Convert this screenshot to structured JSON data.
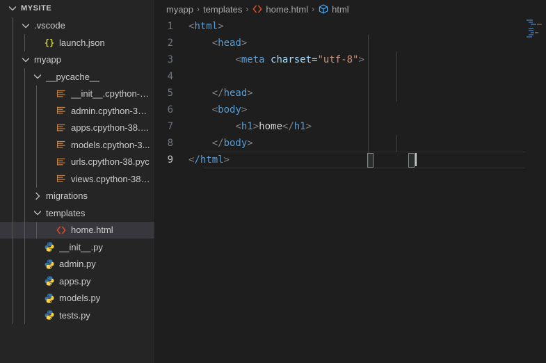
{
  "sidebar": {
    "root": {
      "label": "MYSITE",
      "expanded": true
    },
    "items": [
      {
        "label": ".vscode",
        "type": "folder",
        "depth": 1,
        "expanded": true,
        "icon": "chevron-down-icon"
      },
      {
        "label": "launch.json",
        "type": "file",
        "depth": 2,
        "icon": "json-icon"
      },
      {
        "label": "myapp",
        "type": "folder",
        "depth": 1,
        "expanded": true,
        "icon": "chevron-down-icon"
      },
      {
        "label": "__pycache__",
        "type": "folder",
        "depth": 2,
        "expanded": true,
        "icon": "chevron-down-icon"
      },
      {
        "label": "__init__.cpython-38...",
        "type": "file",
        "depth": 3,
        "icon": "pyc-icon"
      },
      {
        "label": "admin.cpython-38....",
        "type": "file",
        "depth": 3,
        "icon": "pyc-icon"
      },
      {
        "label": "apps.cpython-38.pyc",
        "type": "file",
        "depth": 3,
        "icon": "pyc-icon"
      },
      {
        "label": "models.cpython-3...",
        "type": "file",
        "depth": 3,
        "icon": "pyc-icon"
      },
      {
        "label": "urls.cpython-38.pyc",
        "type": "file",
        "depth": 3,
        "icon": "pyc-icon"
      },
      {
        "label": "views.cpython-38.p...",
        "type": "file",
        "depth": 3,
        "icon": "pyc-icon"
      },
      {
        "label": "migrations",
        "type": "folder",
        "depth": 2,
        "expanded": false,
        "icon": "chevron-right-icon"
      },
      {
        "label": "templates",
        "type": "folder",
        "depth": 2,
        "expanded": true,
        "icon": "chevron-down-icon"
      },
      {
        "label": "home.html",
        "type": "file",
        "depth": 3,
        "icon": "html-icon",
        "selected": true
      },
      {
        "label": "__init__.py",
        "type": "file",
        "depth": 2,
        "icon": "python-icon"
      },
      {
        "label": "admin.py",
        "type": "file",
        "depth": 2,
        "icon": "python-icon"
      },
      {
        "label": "apps.py",
        "type": "file",
        "depth": 2,
        "icon": "python-icon"
      },
      {
        "label": "models.py",
        "type": "file",
        "depth": 2,
        "icon": "python-icon"
      },
      {
        "label": "tests.py",
        "type": "file",
        "depth": 2,
        "icon": "python-icon"
      }
    ]
  },
  "breadcrumbs": [
    {
      "label": "myapp",
      "icon": null
    },
    {
      "label": "templates",
      "icon": null
    },
    {
      "label": "home.html",
      "icon": "html-icon"
    },
    {
      "label": "html",
      "icon": "symbol-cube-icon"
    }
  ],
  "breadcrumb_separator": "›",
  "editor": {
    "language": "html",
    "cursor_line": 9,
    "lines": [
      {
        "number": "1",
        "tokens": [
          {
            "t": "<",
            "c": "punct"
          },
          {
            "t": "html",
            "c": "tag"
          },
          {
            "t": ">",
            "c": "punct"
          }
        ],
        "indent": 0
      },
      {
        "number": "2",
        "tokens": [
          {
            "t": "    ",
            "c": "text"
          },
          {
            "t": "<",
            "c": "punct"
          },
          {
            "t": "head",
            "c": "tag"
          },
          {
            "t": ">",
            "c": "punct"
          }
        ],
        "indent": 1
      },
      {
        "number": "3",
        "tokens": [
          {
            "t": "        ",
            "c": "text"
          },
          {
            "t": "<",
            "c": "punct"
          },
          {
            "t": "meta",
            "c": "tag"
          },
          {
            "t": " ",
            "c": "text"
          },
          {
            "t": "charset",
            "c": "attr"
          },
          {
            "t": "=",
            "c": "eq"
          },
          {
            "t": "\"utf-8\"",
            "c": "str"
          },
          {
            "t": ">",
            "c": "punct"
          }
        ],
        "indent": 2
      },
      {
        "number": "4",
        "tokens": [],
        "indent": 2
      },
      {
        "number": "5",
        "tokens": [
          {
            "t": "    ",
            "c": "text"
          },
          {
            "t": "</",
            "c": "punct"
          },
          {
            "t": "head",
            "c": "tag"
          },
          {
            "t": ">",
            "c": "punct"
          }
        ],
        "indent": 1
      },
      {
        "number": "6",
        "tokens": [
          {
            "t": "    ",
            "c": "text"
          },
          {
            "t": "<",
            "c": "punct"
          },
          {
            "t": "body",
            "c": "tag"
          },
          {
            "t": ">",
            "c": "punct"
          }
        ],
        "indent": 1
      },
      {
        "number": "7",
        "tokens": [
          {
            "t": "        ",
            "c": "text"
          },
          {
            "t": "<",
            "c": "punct"
          },
          {
            "t": "h1",
            "c": "tag"
          },
          {
            "t": ">",
            "c": "punct"
          },
          {
            "t": "home",
            "c": "text"
          },
          {
            "t": "</",
            "c": "punct"
          },
          {
            "t": "h1",
            "c": "tag"
          },
          {
            "t": ">",
            "c": "punct"
          }
        ],
        "indent": 2
      },
      {
        "number": "8",
        "tokens": [
          {
            "t": "    ",
            "c": "text"
          },
          {
            "t": "</",
            "c": "punct"
          },
          {
            "t": "body",
            "c": "tag"
          },
          {
            "t": ">",
            "c": "punct"
          }
        ],
        "indent": 1
      },
      {
        "number": "9",
        "tokens": [
          {
            "t": "<",
            "c": "punct"
          },
          {
            "t": "/html",
            "c": "tag"
          },
          {
            "t": ">",
            "c": "punct"
          }
        ],
        "indent": 0,
        "active": true
      }
    ]
  },
  "colors": {
    "editor_background": "#1e1e1e",
    "sidebar_background": "#252526",
    "selection_background": "#37373d",
    "tag": "#569cd6",
    "attribute": "#9cdcfe",
    "string": "#ce9178",
    "punctuation": "#808080",
    "text": "#d4d4d4",
    "line_number": "#6e7681",
    "line_number_active": "#c6c6c6",
    "html_icon": "#e44d26",
    "json_icon": "#cbcb41",
    "pyc_icon": "#c08040",
    "python_icon": "#3572a5"
  }
}
